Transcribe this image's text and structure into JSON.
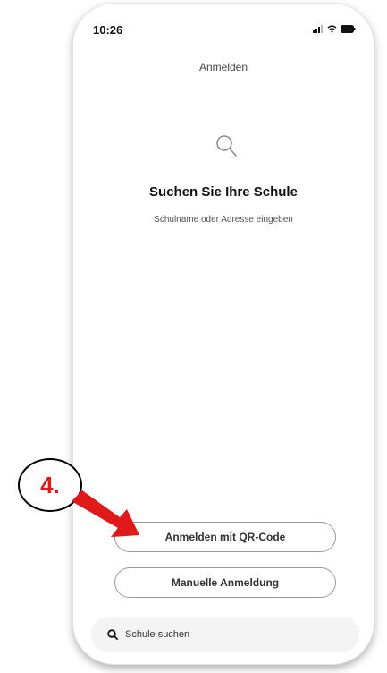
{
  "status_bar": {
    "time": "10:26"
  },
  "nav": {
    "title": "Anmelden"
  },
  "main": {
    "icon": "search-icon",
    "heading": "Suchen Sie Ihre Schule",
    "subtext": "Schulname oder Adresse eingeben"
  },
  "actions": {
    "qr_label": "Anmelden mit QR-Code",
    "manual_label": "Manuelle Anmeldung"
  },
  "search_bar": {
    "label": "Schule suchen",
    "icon": "search-icon"
  },
  "annotation": {
    "step_label": "4.",
    "color": "#e0191b"
  }
}
